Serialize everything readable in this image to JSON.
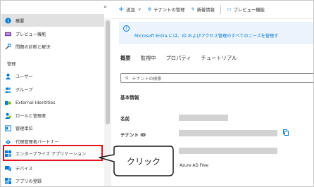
{
  "sidebar": {
    "top_items": [
      {
        "label": "概要",
        "icon": "info-icon",
        "active": true
      },
      {
        "label": "プレビュー機能",
        "icon": "preview-icon"
      },
      {
        "label": "問題の診断と解決",
        "icon": "wrench-icon"
      }
    ],
    "section_label": "管理",
    "items": [
      {
        "label": "ユーザー",
        "icon": "user-icon"
      },
      {
        "label": "グループ",
        "icon": "group-icon"
      },
      {
        "label": "External Identities",
        "icon": "external-identities-icon"
      },
      {
        "label": "ロールと管理者",
        "icon": "roles-icon"
      },
      {
        "label": "管理単位",
        "icon": "admin-units-icon"
      },
      {
        "label": "代理管理者パートナー",
        "icon": "partner-icon"
      },
      {
        "label": "エンタープライズ アプリケーション",
        "icon": "enterprise-apps-icon"
      },
      {
        "label": "デバイス",
        "icon": "devices-icon"
      },
      {
        "label": "アプリの登録",
        "icon": "app-registrations-icon"
      }
    ],
    "collapse_glyph": "«"
  },
  "toolbar": {
    "add_label": "追加",
    "tenant_label": "テナントの管理",
    "whats_new_label": "新着情報",
    "preview_label": "プレビュー機能"
  },
  "banner": {
    "text": "Microsoft Entra には、ID およびアクセス管理のすべてのニーズを管理す"
  },
  "tabs": [
    "概要",
    "監視中",
    "プロパティ",
    "チュートリアル"
  ],
  "search": {
    "placeholder": "テナントの検索"
  },
  "basic_info": {
    "heading": "基本情報",
    "name_label": "名前",
    "tenant_id_label": "テナント ID",
    "license_value": "Azure AD Free"
  },
  "callout": {
    "text": "クリック"
  },
  "colors": {
    "accent": "#0078d4",
    "highlight": "#e3141f"
  }
}
